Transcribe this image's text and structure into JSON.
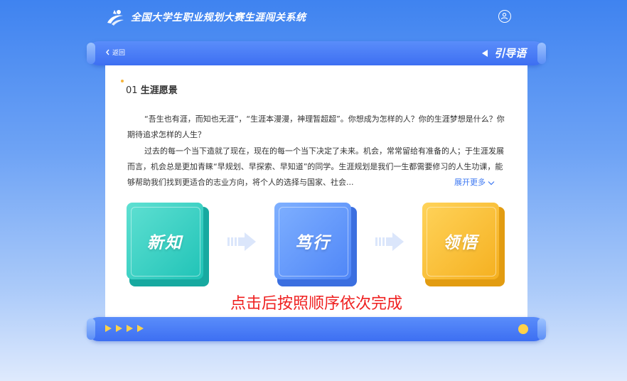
{
  "header": {
    "app_title": "全国大学生职业规划大赛生涯闯关系统"
  },
  "nav": {
    "back_label": "返回",
    "page_title": "引导语"
  },
  "section": {
    "number": "01",
    "title": "生涯愿景",
    "para1": "“吾生也有涯，而知也无涯”，“生涯本漫漫，神理暂超超”。你想成为怎样的人？你的生涯梦想是什么？你期待追求怎样的人生？",
    "para2": "过去的每一个当下造就了现在，现在的每一个当下决定了未来。机会，常常留给有准备的人；于生涯发展而言，机会总是更加青睐“早规划、早探索、早知道”的同学。生涯规划是我们一生都需要修习的人生功课，能够帮助我们找到更适合的志业方向，将个人的选择与国家、社会...",
    "expand_label": "展开更多"
  },
  "steps": [
    {
      "label": "新知",
      "color": "#20c3b7"
    },
    {
      "label": "笃行",
      "color": "#4f86f7"
    },
    {
      "label": "领悟",
      "color": "#f5b020"
    }
  ],
  "hint": "点击后按照顺序依次完成"
}
